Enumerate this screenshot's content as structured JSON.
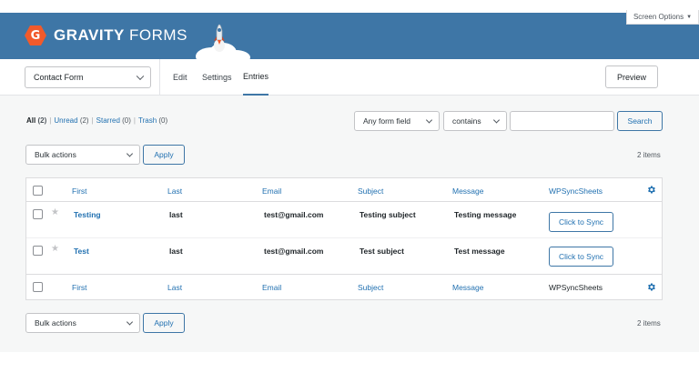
{
  "header": {
    "brand_bold": "GRAVITY",
    "brand_light": " FORMS",
    "logo_letter": "G",
    "screen_options": "Screen Options",
    "colors": {
      "banner": "#3e76a6",
      "logo": "#f15a2b",
      "link": "#2271b1"
    }
  },
  "toolbar": {
    "form_select": "Contact Form",
    "tabs": [
      {
        "label": "Edit"
      },
      {
        "label": "Settings"
      },
      {
        "label": "Entries",
        "active": true
      }
    ],
    "preview_label": "Preview"
  },
  "filters": {
    "all": {
      "label": "All",
      "count": "(2)"
    },
    "unread": {
      "label": "Unread",
      "count": "(2)"
    },
    "starred": {
      "label": "Starred",
      "count": "(0)"
    },
    "trash": {
      "label": "Trash",
      "count": "(0)"
    },
    "separator": "|"
  },
  "search": {
    "field_select": "Any form field",
    "operator_select": "contains",
    "value": "",
    "button": "Search"
  },
  "bulk": {
    "select": "Bulk actions",
    "apply": "Apply",
    "items_count": "2 items"
  },
  "table": {
    "columns": [
      "First",
      "Last",
      "Email",
      "Subject",
      "Message",
      "WPSyncSheets"
    ],
    "rows": [
      {
        "first": "Testing",
        "last": "last",
        "email": "test@gmail.com",
        "subject": "Testing subject",
        "message": "Testing message",
        "sync_label": "Click to Sync",
        "starred": false
      },
      {
        "first": "Test",
        "last": "last",
        "email": "test@gmail.com",
        "subject": "Test subject",
        "message": "Test message",
        "sync_label": "Click to Sync",
        "starred": false
      }
    ],
    "icons": {
      "settings": "gear-icon",
      "star": "star-icon"
    }
  }
}
